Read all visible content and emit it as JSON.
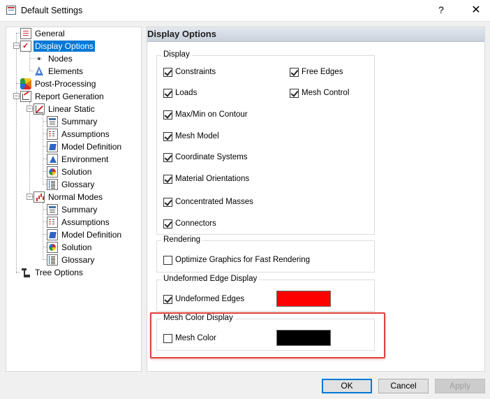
{
  "window": {
    "title": "Default Settings",
    "help_glyph": "?",
    "close_glyph": "✕"
  },
  "tree": {
    "general": "General",
    "display_options": "Display Options",
    "nodes": "Nodes",
    "elements": "Elements",
    "post_processing": "Post-Processing",
    "report_generation": "Report Generation",
    "linear_static": {
      "label": "Linear Static",
      "summary": "Summary",
      "assumptions": "Assumptions",
      "model_definition": "Model Definition",
      "environment": "Environment",
      "solution": "Solution",
      "glossary": "Glossary"
    },
    "normal_modes": {
      "label": "Normal Modes",
      "summary": "Summary",
      "assumptions": "Assumptions",
      "model_definition": "Model Definition",
      "solution": "Solution",
      "glossary": "Glossary"
    },
    "tree_options": "Tree Options",
    "selected": "Display Options"
  },
  "panel": {
    "header": "Display Options",
    "display_group": {
      "title": "Display",
      "options": [
        {
          "label": "Constraints",
          "checked": true
        },
        {
          "label": "Loads",
          "checked": true
        },
        {
          "label": "Max/Min on Contour",
          "checked": true
        },
        {
          "label": "Mesh Model",
          "checked": true
        },
        {
          "label": "Coordinate Systems",
          "checked": true
        },
        {
          "label": "Material Orientations",
          "checked": true
        },
        {
          "label": "Concentrated Masses",
          "checked": true
        },
        {
          "label": "Connectors",
          "checked": true
        },
        {
          "label": "Free Edges",
          "checked": true
        },
        {
          "label": "Mesh Control",
          "checked": true
        }
      ]
    },
    "rendering_group": {
      "title": "Rendering",
      "optimize_label": "Optimize Graphics for Fast Rendering",
      "optimize_checked": false
    },
    "undeformed_group": {
      "title": "Undeformed Edge Display",
      "label": "Undeformed Edges",
      "checked": true,
      "color": "#ff0000"
    },
    "mesh_color_group": {
      "title": "Mesh Color Display",
      "label": "Mesh Color",
      "checked": false,
      "color": "#000000",
      "highlight_color": "#e0423a"
    }
  },
  "buttons": {
    "ok": "OK",
    "cancel": "Cancel",
    "apply": "Apply"
  },
  "colors": {
    "selection": "#0078d7",
    "header_gradient_top": "#e4e8ee",
    "header_gradient_bottom": "#c9d1dc"
  }
}
